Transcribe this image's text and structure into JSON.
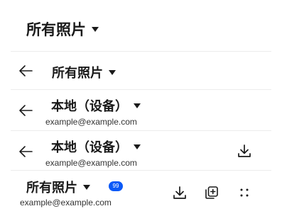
{
  "accent_color": "#0a59f7",
  "bars": [
    {
      "title": "所有照片"
    },
    {
      "title": "所有照片",
      "back_icon": "back-arrow-icon"
    },
    {
      "title": "本地（设备）",
      "subtitle": "example@example.com",
      "back_icon": "back-arrow-icon"
    },
    {
      "title": "本地（设备）",
      "subtitle": "example@example.com",
      "back_icon": "back-arrow-icon",
      "actions": [
        "download-icon"
      ]
    },
    {
      "title": "所有照片",
      "subtitle": "example@example.com",
      "badge": "99",
      "actions": [
        "download-icon",
        "add-box-icon",
        "more-dots-icon"
      ]
    }
  ]
}
